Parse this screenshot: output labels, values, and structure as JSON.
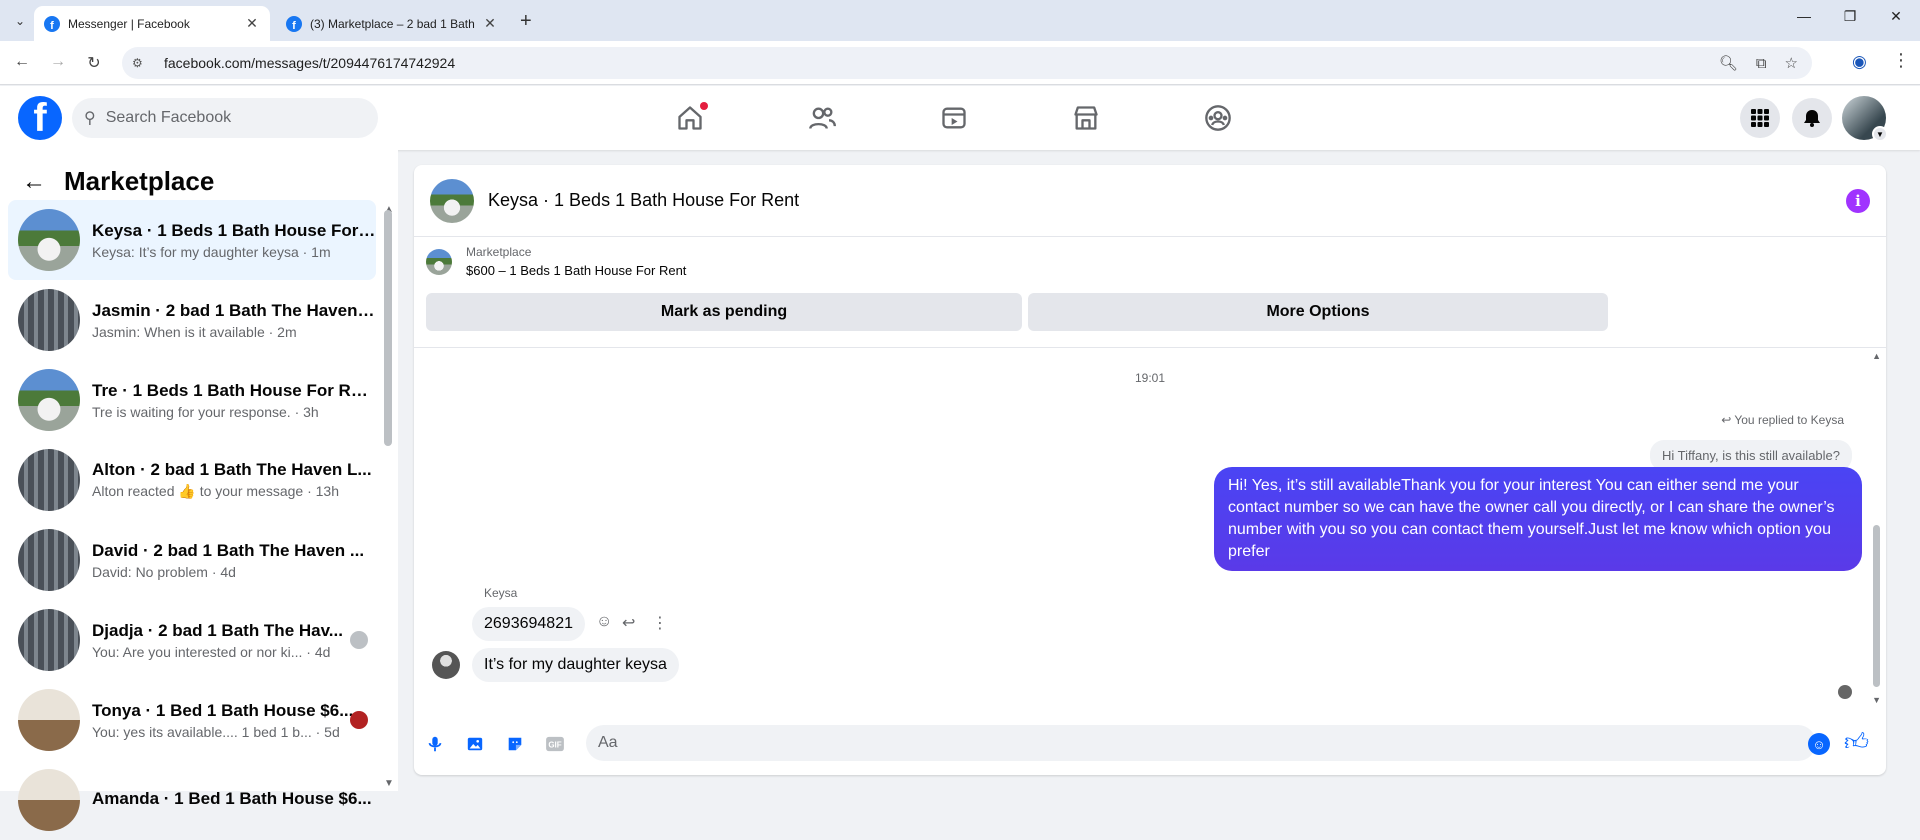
{
  "browser": {
    "tabs": [
      {
        "title": "Messenger | Facebook",
        "active": true
      },
      {
        "title": "(3) Marketplace – 2 bad 1 Bath",
        "active": false
      }
    ],
    "url": "facebook.com/messages/t/2094476174742924"
  },
  "fb": {
    "search_placeholder": "Search Facebook",
    "nav_icons": [
      "home-icon",
      "friends-icon",
      "video-icon",
      "marketplace-icon",
      "groups-icon"
    ],
    "accent": "#0866ff"
  },
  "sidebar": {
    "title": "Marketplace",
    "conversations": [
      {
        "name": "Keysa · 1 Beds 1 Bath House For ...",
        "snippet": "Keysa: It’s for my daughter keysa · 1m",
        "thumb": "house",
        "active": true
      },
      {
        "name": "Jasmin · 2 bad 1 Bath The Haven ...",
        "snippet": "Jasmin: When is it available · 2m",
        "thumb": "apt"
      },
      {
        "name": "Tre · 1 Beds 1 Bath House For Rent",
        "snippet": "Tre is waiting for your response. · 3h",
        "thumb": "house"
      },
      {
        "name": "Alton · 2 bad 1 Bath The Haven L...",
        "snippet": "Alton reacted 👍 to your message · 13h",
        "thumb": "apt"
      },
      {
        "name": "David · 2 bad 1 Bath The Haven ...",
        "snippet": "David: No problem · 4d",
        "thumb": "apt"
      },
      {
        "name": "Djadja · 2 bad 1 Bath The Hav...",
        "snippet": "You: Are you interested or nor ki... · 4d",
        "thumb": "apt",
        "mini": "#bcc0c4"
      },
      {
        "name": "Tonya · 1 Bed 1 Bath House $6...",
        "snippet": "You: yes its available.... 1 bed 1 b... · 5d",
        "thumb": "room",
        "mini": "#b22222"
      },
      {
        "name": "Amanda · 1 Bed 1 Bath House $6...",
        "snippet": "",
        "thumb": "room"
      }
    ]
  },
  "chat": {
    "title": "Keysa · 1 Beds 1 Bath House For Rent",
    "listing_label": "Marketplace",
    "listing_detail": "$600 – 1 Beds 1 Bath House For Rent",
    "mark_pending": "Mark as pending",
    "more_options": "More Options",
    "timestamp": "19:01",
    "replied_to": "You replied to Keysa",
    "quoted": "Hi Tiffany, is this still available?",
    "sent_message": "Hi! Yes, it’s still availableThank you for your interest You can either send me your contact number so we can have the owner call you directly, or I can share the owner’s number with you so you can contact them yourself.Just let me know which option you prefer",
    "sender_name": "Keysa",
    "received": [
      "2693694821",
      "It’s for my daughter keysa"
    ],
    "composer_placeholder": "Aa",
    "sent_bubble_color": "#4c3bf0"
  }
}
